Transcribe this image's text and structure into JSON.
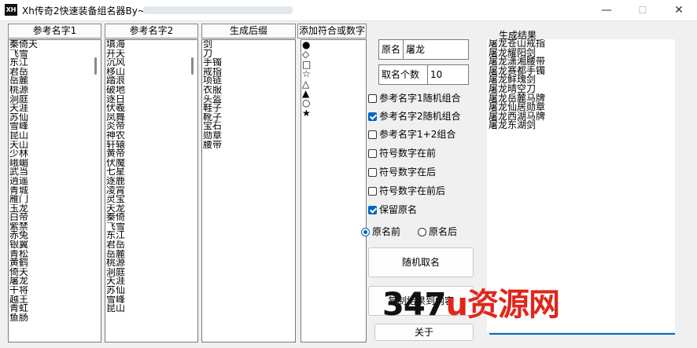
{
  "window": {
    "title": "Xh传奇2快速装备组名器By~",
    "app_icon_text": "XH",
    "min_glyph": "—",
    "max_glyph": "☐",
    "close_glyph": "✕"
  },
  "columns": {
    "ref1": {
      "header": "参考名字1",
      "items": [
        "秦倚天",
        "飞雪",
        "东江",
        "君岳",
        "岳麓",
        "桃源",
        "洞庭",
        "天涯",
        "苏仙",
        "雪峰",
        "昆山",
        "天山",
        "少林",
        "峨嵋",
        "武当",
        "逍遥",
        "青城",
        "雁门",
        "玉龙",
        "白帝",
        "紫禁",
        "赤兔",
        "银翼",
        "青松",
        "黄鹤",
        "倚天",
        "屠龙",
        "干将",
        "越王",
        "青虹",
        "鱼肠"
      ]
    },
    "ref2": {
      "header": "参考名字2",
      "items": [
        "填海",
        "开天",
        "沉风",
        "移山",
        "踏浪",
        "破地",
        "逐日",
        "伏羲",
        "凤舞",
        "炎帝",
        "神农",
        "轩辕",
        "黄帝",
        "伏魔",
        "七星",
        "逐鹿",
        "凌霄",
        "灵宝",
        "天龙",
        "秦倚",
        "飞雪",
        "东江",
        "君岳",
        "岳麓",
        "桃源",
        "洞庭",
        "天涯",
        "苏仙",
        "雪峰",
        "昆山"
      ]
    },
    "suffix": {
      "header": "生成后缀",
      "items": [
        "剑",
        "刀",
        "手镯",
        "戒指",
        "项链",
        "衣服",
        "头盔",
        "鞋子",
        "靴子",
        "宝石",
        "勋章",
        "腰带"
      ]
    },
    "symbols": {
      "header": "添加符合或数字",
      "items": [
        "●",
        "◇",
        "□",
        "☆",
        "△",
        "▲",
        "○",
        "★"
      ]
    }
  },
  "options": {
    "original_name_label": "原名",
    "original_name_value": "屠龙",
    "count_label": "取名个数",
    "count_value": "10",
    "checks": [
      {
        "label": "参考名字1随机组合",
        "checked": false
      },
      {
        "label": "参考名字2随机组合",
        "checked": true
      },
      {
        "label": "参考名字1+2组合",
        "checked": false
      },
      {
        "label": "符号数字在前",
        "checked": false
      },
      {
        "label": "符号数字在后",
        "checked": false
      },
      {
        "label": "符号数字在前后",
        "checked": false
      },
      {
        "label": "保留原名",
        "checked": true
      }
    ],
    "radios": [
      {
        "label": "原名前",
        "checked": true
      },
      {
        "label": "原名后",
        "checked": false
      }
    ]
  },
  "buttons": {
    "random": "随机取名",
    "copy": "复制结果到内容",
    "about": "关于"
  },
  "results": {
    "header": "生成结果",
    "items": [
      "屠龙苍山戒指",
      "屠龙耀阳剑",
      "屠龙潇湘腰带",
      "屠龙赛都手镯",
      "屠龙鲜瑰剑",
      "屠龙晴空刀",
      "屠龙岳麓马牌",
      "屠龙仙居勋章",
      "屠龙西湖马牌",
      "屠龙东湖剑"
    ]
  },
  "watermark": {
    "num": "347",
    "u": "u",
    "cn": "资源网"
  }
}
